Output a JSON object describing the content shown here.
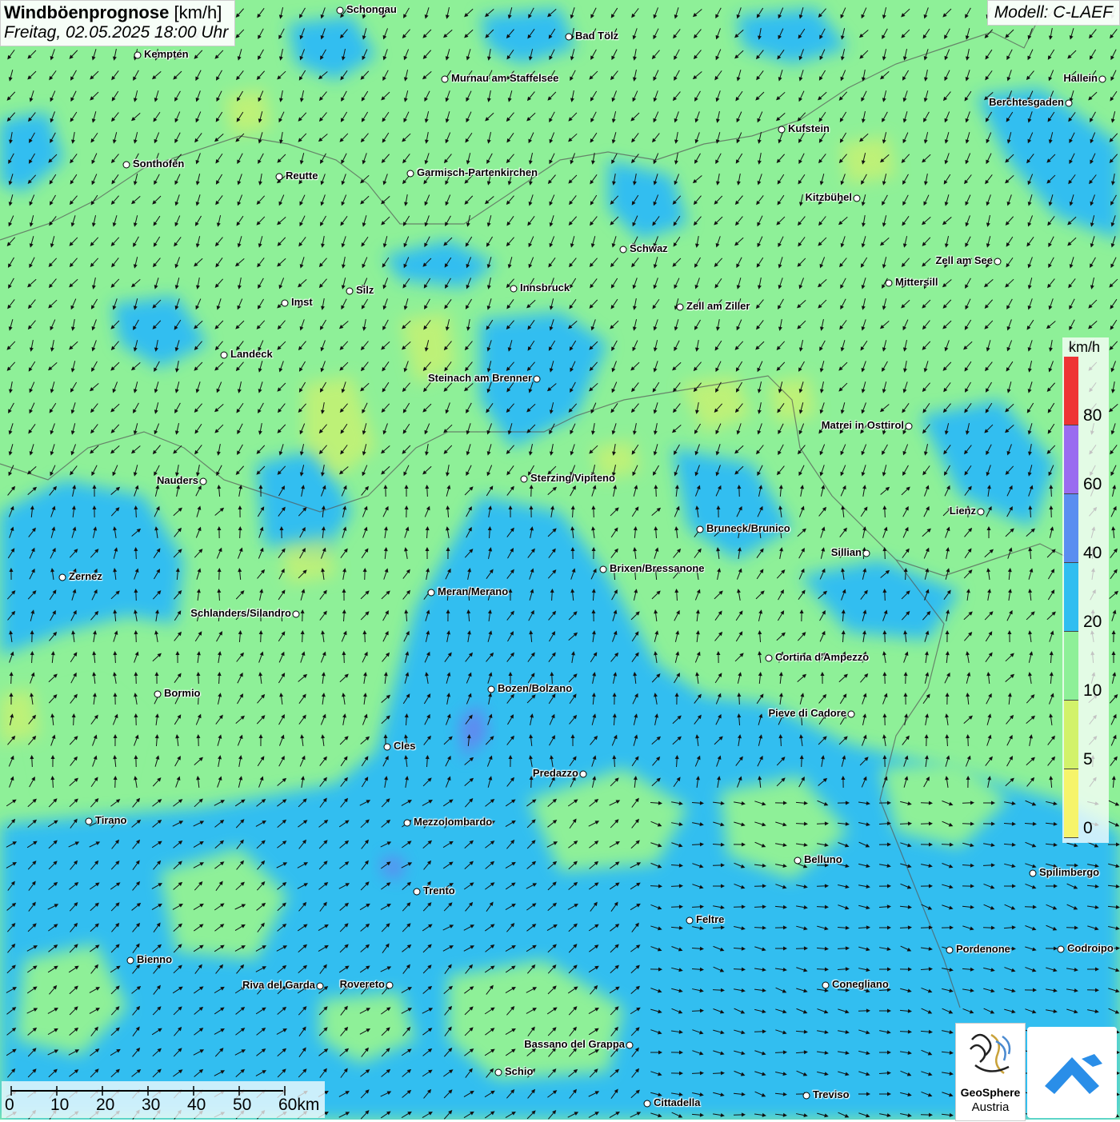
{
  "header": {
    "title_bold": "Windböenprognose",
    "title_unit": " [km/h]",
    "subtitle": "Freitag, 02.05.2025 18:00 Uhr",
    "model": "Modell: C-LAEF"
  },
  "legend": {
    "unit": "km/h",
    "labels": [
      "80",
      "60",
      "40",
      "20",
      "10",
      "5",
      "0"
    ],
    "colors": [
      "#ee3434",
      "#9a6cf0",
      "#5a8ef0",
      "#30bef0",
      "#8ef098",
      "#d2f26a",
      "#f6f46a"
    ]
  },
  "scalebar": {
    "labels": [
      "0",
      "10",
      "20",
      "30",
      "40",
      "50",
      "60km"
    ]
  },
  "logos": {
    "geosphere_line1": "GeoSphere",
    "geosphere_line2": "Austria"
  },
  "cities": [
    {
      "name": "Schongau",
      "side": "right"
    },
    {
      "name": "Bad Tölz",
      "side": "right"
    },
    {
      "name": "Kempten",
      "side": "right"
    },
    {
      "name": "Murnau am Staffelsee",
      "side": "right"
    },
    {
      "name": "Hallein",
      "side": "left"
    },
    {
      "name": "Berchtesgaden",
      "side": "left"
    },
    {
      "name": "Kufstein",
      "side": "right"
    },
    {
      "name": "Sonthofen",
      "side": "right"
    },
    {
      "name": "Reutte",
      "side": "right"
    },
    {
      "name": "Garmisch-Partenkirchen",
      "side": "right"
    },
    {
      "name": "Kitzbühel",
      "side": "left"
    },
    {
      "name": "Schwaz",
      "side": "right"
    },
    {
      "name": "Zell am See",
      "side": "left"
    },
    {
      "name": "Mittersill",
      "side": "right"
    },
    {
      "name": "Innsbruck",
      "side": "right"
    },
    {
      "name": "Silz",
      "side": "right"
    },
    {
      "name": "Imst",
      "side": "right"
    },
    {
      "name": "Zell am Ziller",
      "side": "right"
    },
    {
      "name": "Landeck",
      "side": "right"
    },
    {
      "name": "Steinach am Brenner",
      "side": "left"
    },
    {
      "name": "Matrei in Osttirol",
      "side": "left"
    },
    {
      "name": "Nauders",
      "side": "left"
    },
    {
      "name": "Sterzing/Vipiteno",
      "side": "right"
    },
    {
      "name": "Lienz",
      "side": "left"
    },
    {
      "name": "Bruneck/Brunico",
      "side": "right"
    },
    {
      "name": "Sillian",
      "side": "left"
    },
    {
      "name": "Zernez",
      "side": "right"
    },
    {
      "name": "Brixen/Bressanone",
      "side": "right"
    },
    {
      "name": "Meran/Merano",
      "side": "right"
    },
    {
      "name": "Schlanders/Silandro",
      "side": "left"
    },
    {
      "name": "Cortina d'Ampezzo",
      "side": "right"
    },
    {
      "name": "Bormio",
      "side": "right"
    },
    {
      "name": "Bozen/Bolzano",
      "side": "right"
    },
    {
      "name": "Pieve di Cadore",
      "side": "left"
    },
    {
      "name": "Cles",
      "side": "right"
    },
    {
      "name": "Predazzo",
      "side": "left"
    },
    {
      "name": "Tirano",
      "side": "right"
    },
    {
      "name": "Mezzolombardo",
      "side": "right"
    },
    {
      "name": "Belluno",
      "side": "right"
    },
    {
      "name": "Spilimbergo",
      "side": "right"
    },
    {
      "name": "Trento",
      "side": "right"
    },
    {
      "name": "Feltre",
      "side": "right"
    },
    {
      "name": "Pordenone",
      "side": "right"
    },
    {
      "name": "Codroipo",
      "side": "right"
    },
    {
      "name": "Bienno",
      "side": "right"
    },
    {
      "name": "Riva del Garda",
      "side": "left"
    },
    {
      "name": "Rovereto",
      "side": "left"
    },
    {
      "name": "Conegliano",
      "side": "right"
    },
    {
      "name": "Bassano del Grappa",
      "side": "left"
    },
    {
      "name": "Schio",
      "side": "right"
    },
    {
      "name": "Treviso",
      "side": "right"
    },
    {
      "name": "Cittadella",
      "side": "right"
    }
  ]
}
